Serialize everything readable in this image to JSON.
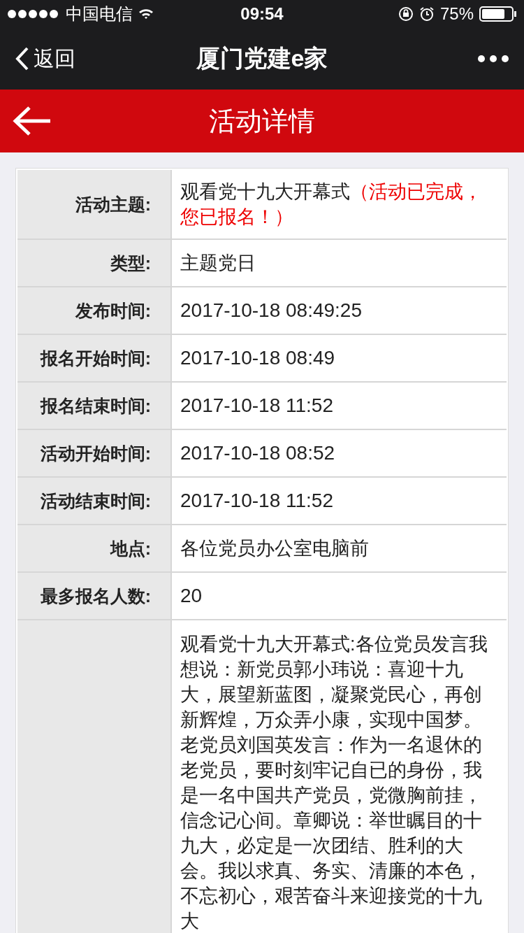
{
  "status_bar": {
    "carrier": "中国电信",
    "time": "09:54",
    "battery": "75%"
  },
  "nav_bar": {
    "back": "返回",
    "title": "厦门党建e家"
  },
  "header": {
    "title": "活动详情"
  },
  "details": [
    {
      "label": "活动主题:",
      "value": "观看党十九大开幕式",
      "note": "（活动已完成，您已报名！）"
    },
    {
      "label": "类型:",
      "value": "主题党日"
    },
    {
      "label": "发布时间:",
      "value": "2017-10-18 08:49:25"
    },
    {
      "label": "报名开始时间:",
      "value": "2017-10-18 08:49"
    },
    {
      "label": "报名结束时间:",
      "value": "2017-10-18 11:52"
    },
    {
      "label": "活动开始时间:",
      "value": "2017-10-18 08:52"
    },
    {
      "label": "活动结束时间:",
      "value": "2017-10-18 11:52"
    },
    {
      "label": "地点:",
      "value": "各位党员办公室电脑前"
    },
    {
      "label": "最多报名人数:",
      "value": "20"
    },
    {
      "value": "观看党十九大开幕式:各位党员发言我想说：新党员郭小玮说：喜迎十九大，展望新蓝图，凝聚党民心，再创新辉煌，万众弄小康，实现中国梦。老党员刘国英发言：作为一名退休的老党员，要时刻牢记自已的身份，我是一名中国共产党员，党微胸前挂，信念记心间。章卿说：举世瞩目的十九大，必定是一次团结、胜利的大会。我以求真、务实、清廉的本色，不忘初心，艰苦奋斗来迎接党的十九大"
    }
  ]
}
